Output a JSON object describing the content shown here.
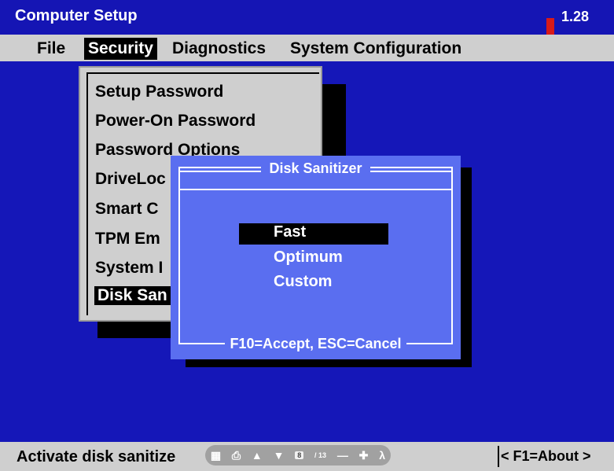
{
  "app": {
    "title": "Computer Setup",
    "version": "1.28"
  },
  "menu": {
    "items": [
      {
        "label": "File"
      },
      {
        "label": "Security"
      },
      {
        "label": "Diagnostics"
      },
      {
        "label": "System Configuration"
      }
    ],
    "active": "Security"
  },
  "security_menu": {
    "items": [
      {
        "label": "Setup Password"
      },
      {
        "label": "Power-On Password"
      },
      {
        "label": "Password Options"
      },
      {
        "label": "DriveLoc"
      },
      {
        "label": "Smart C"
      },
      {
        "label": "TPM Em"
      },
      {
        "label": "System I"
      },
      {
        "label": "Disk San"
      }
    ],
    "selected": "Disk San"
  },
  "dialog": {
    "title": "Disk Sanitizer",
    "options": [
      {
        "label": "Fast"
      },
      {
        "label": "Optimum"
      },
      {
        "label": "Custom"
      }
    ],
    "selected": "Fast",
    "footer": "F10=Accept,  ESC=Cancel"
  },
  "statusbar": {
    "message": "Activate disk sanitize",
    "help": "< F1=About >"
  },
  "pdf_toolbar": {
    "page": "8",
    "total": "/ 13"
  },
  "colors": {
    "background": "#1517b8",
    "dialog": "#5a6ef0",
    "menubar": "#cfcfcf",
    "highlight": "#000000",
    "version_marker": "#d81a1a"
  }
}
